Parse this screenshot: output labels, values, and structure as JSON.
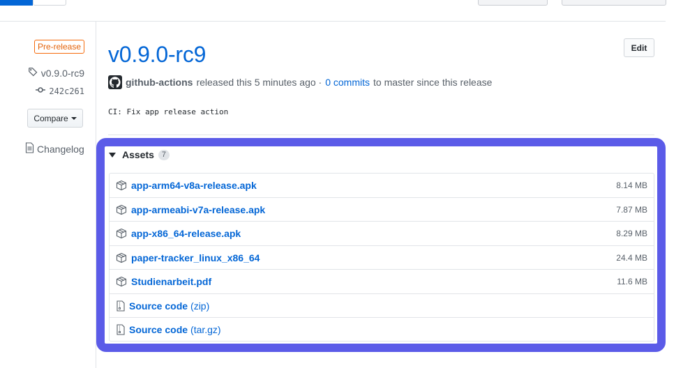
{
  "sidebar": {
    "badge": "Pre-release",
    "tag": "v0.9.0-rc9",
    "commit": "242c261",
    "compare_label": "Compare",
    "changelog_label": "Changelog"
  },
  "release": {
    "title": "v0.9.0-rc9",
    "edit_label": "Edit",
    "author": "github-actions",
    "released_text": "released this 5 minutes ago ·",
    "commits_link": "0 commits",
    "commits_suffix": "to master since this release",
    "notes": "CI: Fix app release action"
  },
  "assets": {
    "label": "Assets",
    "count": "7",
    "files": [
      {
        "name": "app-arm64-v8a-release.apk",
        "size": "8.14 MB"
      },
      {
        "name": "app-armeabi-v7a-release.apk",
        "size": "7.87 MB"
      },
      {
        "name": "app-x86_64-release.apk",
        "size": "8.29 MB"
      },
      {
        "name": "paper-tracker_linux_x86_64",
        "size": "24.4 MB"
      },
      {
        "name": "Studienarbeit.pdf",
        "size": "11.6 MB"
      }
    ],
    "sources": [
      {
        "name": "Source code",
        "ext": "(zip)"
      },
      {
        "name": "Source code",
        "ext": "(tar.gz)"
      }
    ]
  },
  "colors": {
    "link": "#0366d6",
    "prerelease": "#e36209",
    "highlight": "#5b5be8"
  },
  "icons": [
    "tag-icon",
    "commit-icon",
    "caret-down-icon",
    "file-icon",
    "package-icon",
    "file-zip-icon",
    "github-logo-icon"
  ]
}
